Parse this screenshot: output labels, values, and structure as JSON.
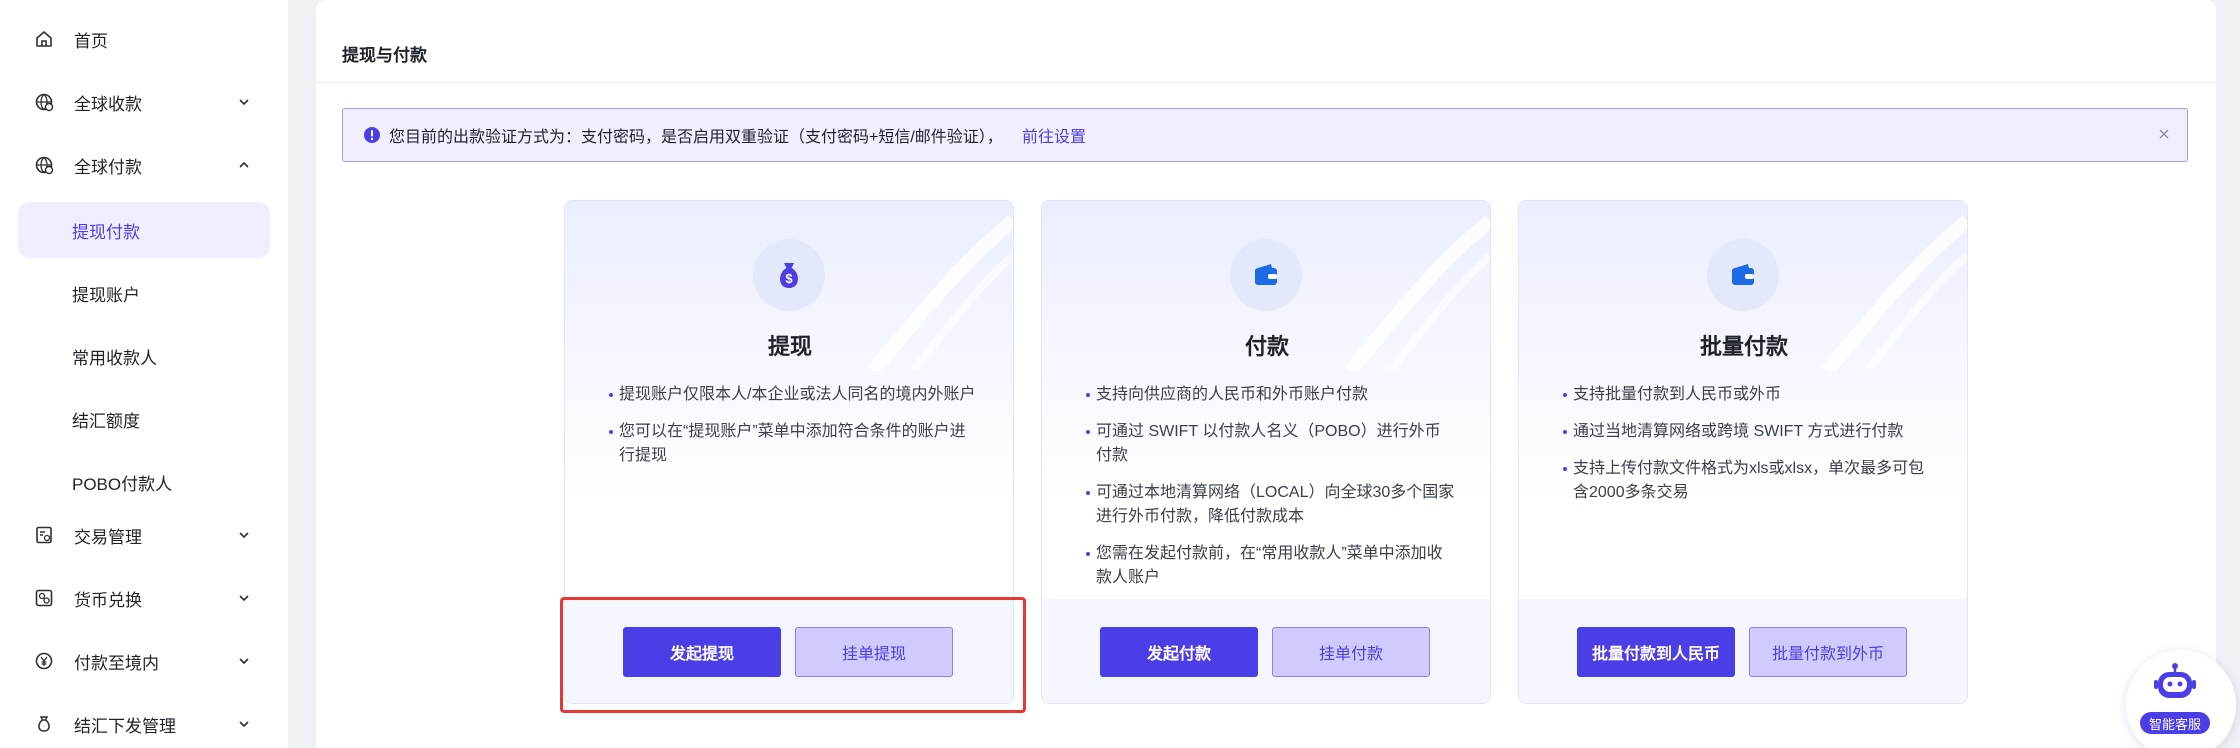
{
  "sidebar": {
    "items": [
      {
        "label": "首页",
        "icon": "home-icon"
      },
      {
        "label": "全球收款",
        "icon": "globe-receive-icon"
      },
      {
        "label": "全球付款",
        "icon": "globe-pay-icon"
      },
      {
        "label": "交易管理",
        "icon": "transaction-icon"
      },
      {
        "label": "货币兑换",
        "icon": "exchange-icon"
      },
      {
        "label": "付款至境内",
        "icon": "yuan-icon"
      },
      {
        "label": "结汇下发管理",
        "icon": "money-bag-icon"
      }
    ],
    "sub_items": [
      {
        "label": "提现付款",
        "active": true
      },
      {
        "label": "提现账户",
        "active": false
      },
      {
        "label": "常用收款人",
        "active": false
      },
      {
        "label": "结汇额度",
        "active": false
      },
      {
        "label": "POBO付款人",
        "active": false
      }
    ]
  },
  "page": {
    "title": "提现与付款"
  },
  "alert": {
    "text": "您目前的出款验证方式为：支付密码，是否启用双重验证（支付密码+短信/邮件验证），",
    "link": "前往设置"
  },
  "cards": [
    {
      "title": "提现",
      "icon": "money-bag-icon",
      "bullets": [
        "提现账户仅限本人/本企业或法人同名的境内外账户",
        "您可以在“提现账户”菜单中添加符合条件的账户进行提现"
      ],
      "primary": "发起提现",
      "secondary": "挂单提现"
    },
    {
      "title": "付款",
      "icon": "wallet-icon",
      "bullets": [
        "支持向供应商的人民币和外币账户付款",
        "可通过 SWIFT 以付款人名义（POBO）进行外币付款",
        "可通过本地清算网络（LOCAL）向全球30多个国家进行外币付款，降低付款成本",
        "您需在发起付款前，在“常用收款人”菜单中添加收款人账户"
      ],
      "primary": "发起付款",
      "secondary": "挂单付款"
    },
    {
      "title": "批量付款",
      "icon": "wallet-icon",
      "bullets": [
        "支持批量付款到人民币或外币",
        "通过当地清算网络或跨境 SWIFT 方式进行付款",
        "支持上传付款文件格式为xls或xlsx，单次最多可包含2000多条交易"
      ],
      "primary": "批量付款到人民币",
      "secondary": "批量付款到外币"
    }
  ],
  "assistant": {
    "label": "智能客服"
  },
  "colors": {
    "accent": "#4c3ee6",
    "accent_light": "#cfcbfd",
    "highlight": "#e53935"
  }
}
